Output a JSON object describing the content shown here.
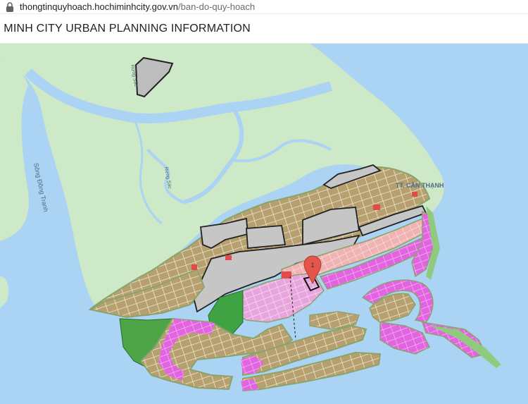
{
  "browser": {
    "url_host": "thongtinquyhoach.hochiminhcity.gov.vn",
    "url_path": "/ban-do-quy-hoach"
  },
  "header": {
    "title": "I MINH CITY URBAN PLANNING INFORMATION"
  },
  "map": {
    "labels": {
      "river_left": "Sông Đồng Tranh",
      "river_small": "Rừng Sác",
      "river_small2": "Rừng Sác",
      "town": "TT. CẦN THẠNH"
    },
    "marker_number": "1",
    "colors": {
      "sea": "#abd3f3",
      "land": "#cde9c7",
      "residential": "#b39c6b",
      "commercial": "#e39bd9",
      "resort": "#e25fe0",
      "park": "#3fa243",
      "reserved": "#bdbdbd",
      "marker": "#e4564a"
    }
  }
}
